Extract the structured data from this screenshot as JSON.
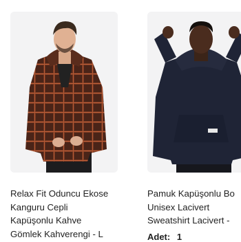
{
  "products": [
    {
      "title_lines": [
        "Relax Fit Oduncu Ekose",
        "Kanguru Cepli",
        "Kapüşonlu Kahve",
        "Gömlek Kahverengi - L"
      ],
      "image_alt": "man in brown plaid hooded shirt"
    },
    {
      "title_lines": [
        "Pamuk Kapüşonlu Bo",
        "Unisex Lacivert",
        "Sweatshirt Lacivert -"
      ],
      "image_alt": "man in navy hoodie",
      "quantity_label": "Adet:",
      "quantity_value": "1"
    }
  ]
}
